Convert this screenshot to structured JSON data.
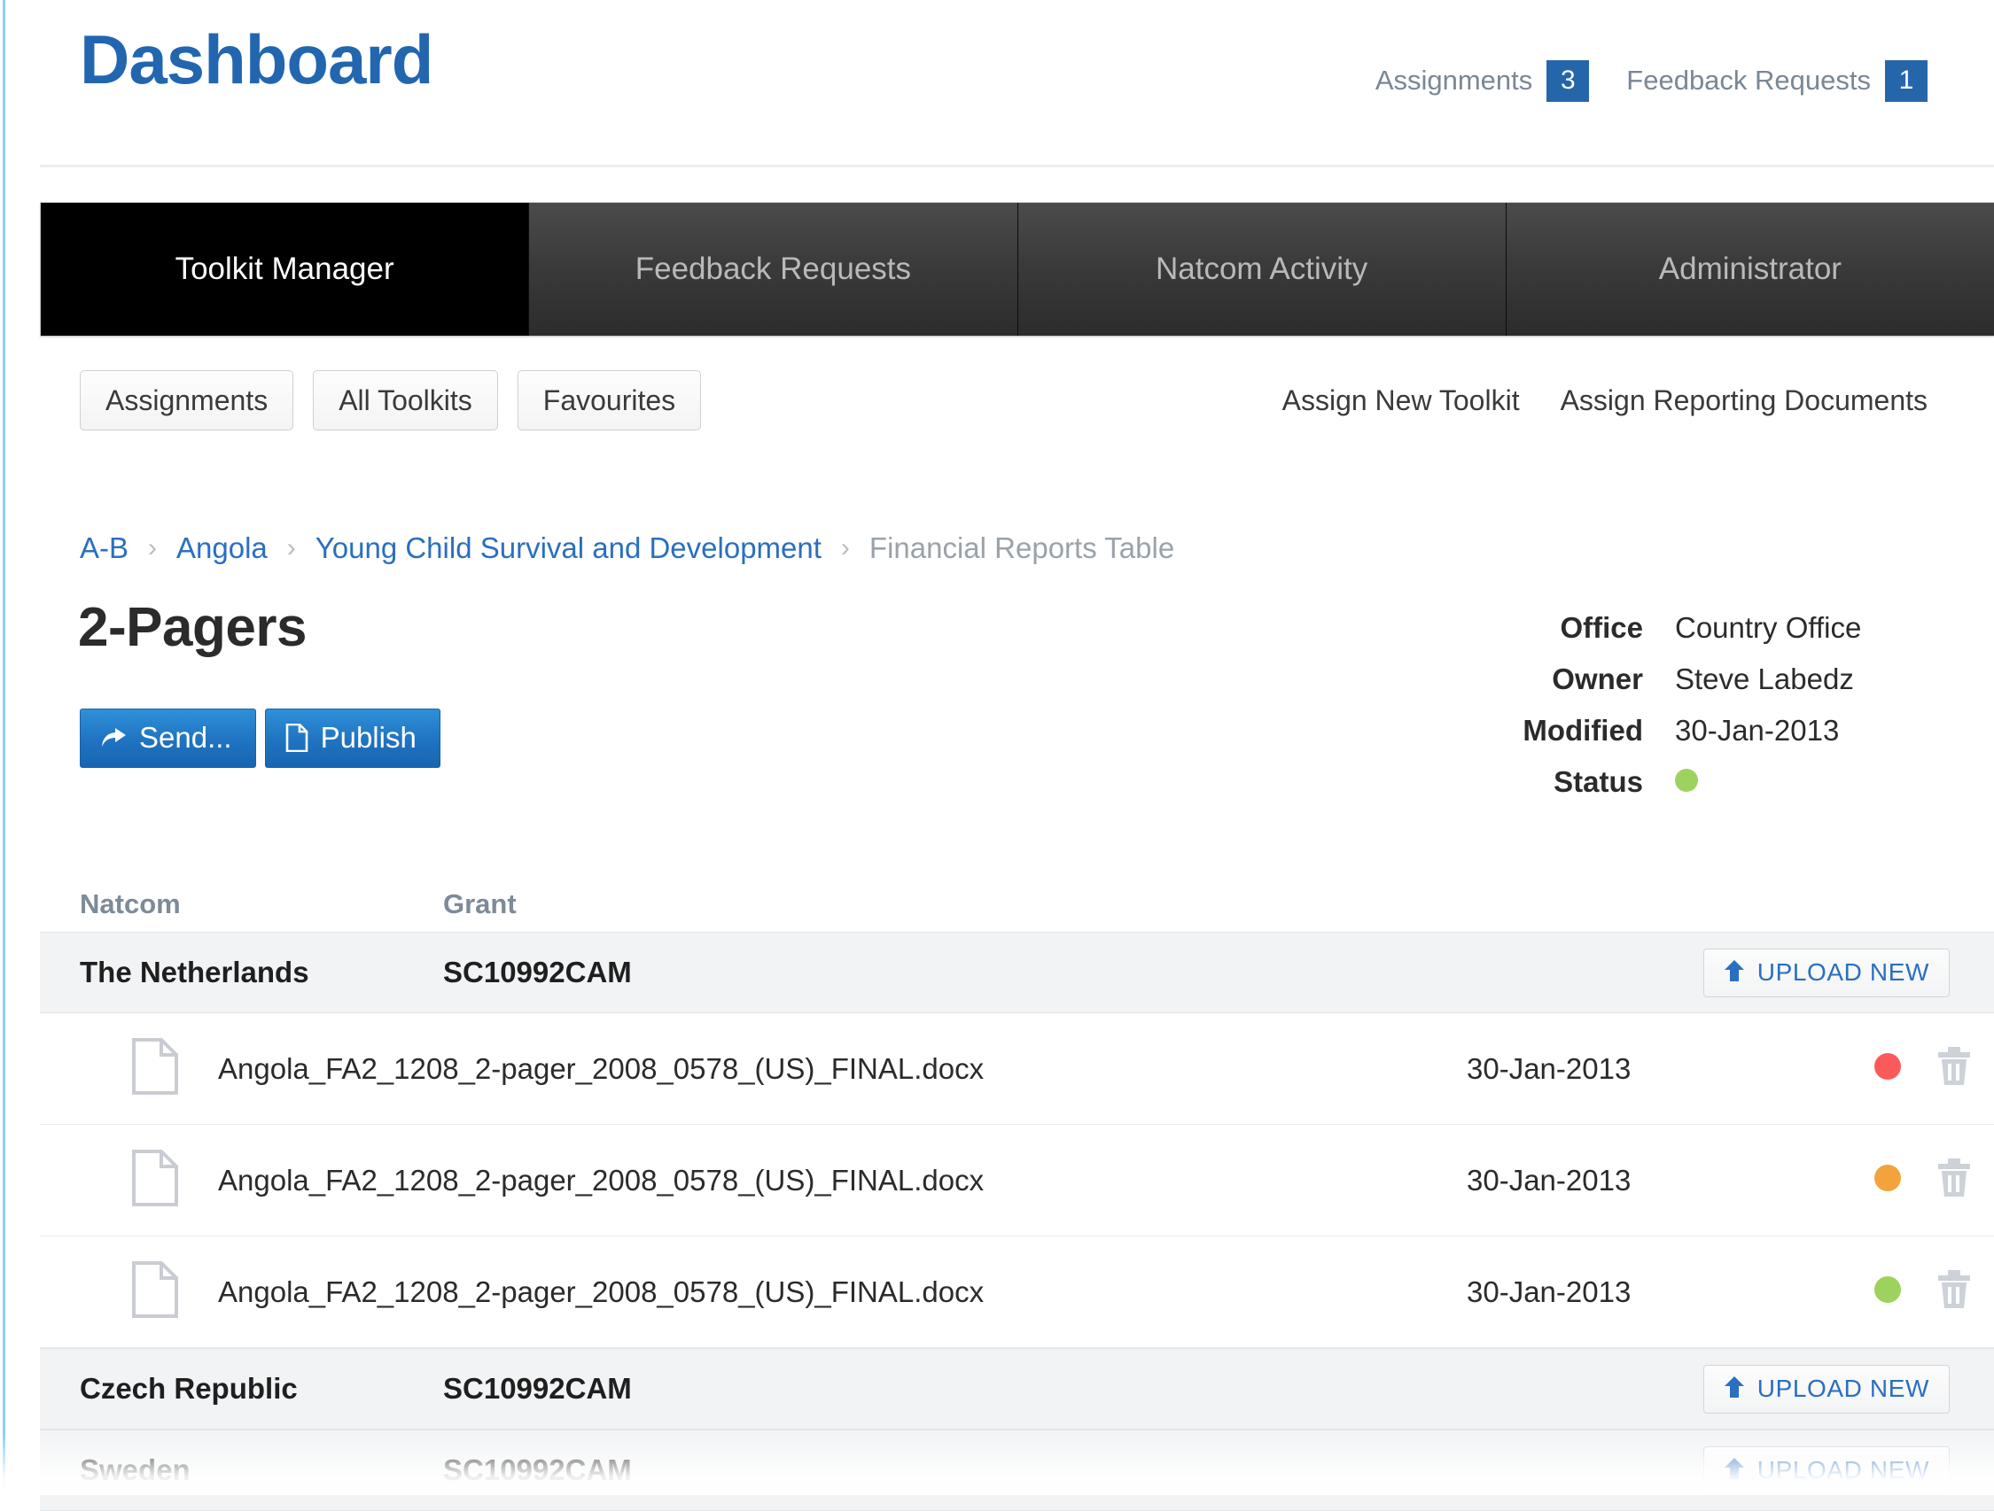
{
  "header": {
    "title": "Dashboard",
    "counters": [
      {
        "label": "Assignments",
        "count": "3"
      },
      {
        "label": "Feedback Requests",
        "count": "1"
      }
    ]
  },
  "tabs": [
    {
      "label": "Toolkit Manager",
      "active": true
    },
    {
      "label": "Feedback Requests",
      "active": false
    },
    {
      "label": "Natcom Activity",
      "active": false
    },
    {
      "label": "Administrator",
      "active": false
    }
  ],
  "subbar": {
    "filters": [
      "Assignments",
      "All Toolkits",
      "Favourites"
    ],
    "links": [
      "Assign New Toolkit",
      "Assign Reporting Documents"
    ]
  },
  "breadcrumb": {
    "items": [
      "A-B",
      "Angola",
      "Young Child Survival and Development"
    ],
    "current": "Financial Reports Table",
    "separator": "›"
  },
  "document": {
    "title": "2-Pagers",
    "actions": [
      {
        "label": "Send...",
        "icon": "share-arrow-icon"
      },
      {
        "label": "Publish",
        "icon": "document-icon"
      }
    ]
  },
  "meta": {
    "rows": [
      {
        "key": "Office",
        "value": "Country Office"
      },
      {
        "key": "Owner",
        "value": "Steve Labedz"
      },
      {
        "key": "Modified",
        "value": "30-Jan-2013"
      }
    ],
    "status_key": "Status",
    "status_color": "#9dd25f"
  },
  "table": {
    "columns": [
      "Natcom",
      "Grant"
    ],
    "upload_label": "UPLOAD NEW",
    "groups": [
      {
        "natcom": "The Netherlands",
        "grant": "SC10992CAM",
        "files": [
          {
            "name": "Angola_FA2_1208_2-pager_2008_0578_(US)_FINAL.docx",
            "date": "30-Jan-2013",
            "status_color": "#fc5a5a"
          },
          {
            "name": "Angola_FA2_1208_2-pager_2008_0578_(US)_FINAL.docx",
            "date": "30-Jan-2013",
            "status_color": "#f2a33c"
          },
          {
            "name": "Angola_FA2_1208_2-pager_2008_0578_(US)_FINAL.docx",
            "date": "30-Jan-2013",
            "status_color": "#9dd25f"
          }
        ]
      },
      {
        "natcom": "Czech Republic",
        "grant": "SC10992CAM",
        "files": []
      },
      {
        "natcom": "Sweden",
        "grant": "SC10992CAM",
        "files": []
      }
    ]
  },
  "colors": {
    "brand_blue": "#2266b0",
    "link_blue": "#2a6fc0",
    "badge_blue": "#2566ab",
    "status_red": "#fc5a5a",
    "status_orange": "#f2a33c",
    "status_green": "#9dd25f"
  }
}
